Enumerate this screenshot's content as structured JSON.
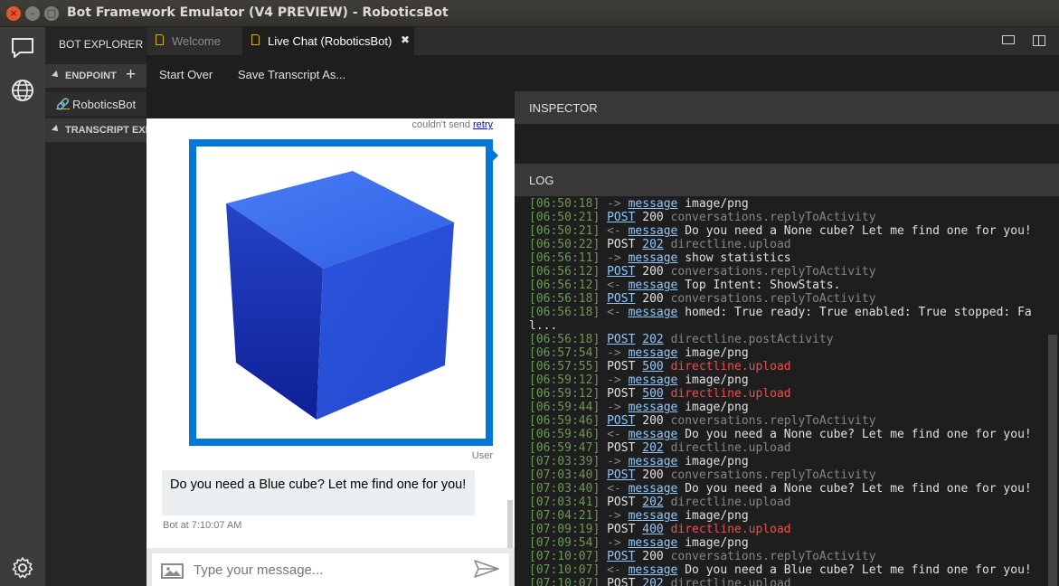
{
  "window": {
    "title": "Bot Framework Emulator (V4 PREVIEW) - RoboticsBot",
    "close_glyph": "×",
    "minimize_glyph": "–",
    "maximize_glyph": "□"
  },
  "activity_bar": {
    "icons": [
      "chat-icon",
      "globe-icon",
      "settings-gear-icon"
    ]
  },
  "explorer": {
    "title": "BOT EXPLORER",
    "endpoint_section": "ENDPOINT",
    "add_glyph": "+",
    "endpoint_item": "RoboticsBot",
    "transcript_section": "TRANSCRIPT EXPLORER"
  },
  "tabs": [
    {
      "label": "Welcome",
      "active": false
    },
    {
      "label": "Live Chat (RoboticsBot)",
      "active": true,
      "close_glyph": "✖"
    }
  ],
  "toolbar": {
    "start_over": "Start Over",
    "save_transcript": "Save Transcript As..."
  },
  "chat": {
    "status_text": "couldn't send",
    "retry_label": "retry",
    "user_label": "User",
    "bot_message": "Do you need a Blue cube? Let me find one for you!",
    "bot_time": "Bot at 7:10:07 AM",
    "input_placeholder": "Type your message...",
    "image_subject": "blue cube"
  },
  "inspector": {
    "title": "INSPECTOR"
  },
  "log": {
    "title": "LOG",
    "colors": {
      "timestamp": "#6a9955",
      "link": "#8ec8ff",
      "dim": "#858585",
      "error": "#f14c4c"
    },
    "entries": [
      {
        "time": "[06:50:18]",
        "dir": "->",
        "kind": "link",
        "method": "message",
        "detail": "image/png",
        "detail_style": "text"
      },
      {
        "time": "[06:50:21]",
        "dir": "",
        "kind": "link",
        "method": "POST",
        "status": "200",
        "status_style": "text",
        "detail": "conversations.replyToActivity",
        "detail_style": "dim"
      },
      {
        "time": "[06:50:21]",
        "dir": "<-",
        "kind": "link",
        "method": "message",
        "detail": "Do you need a None cube? Let me find one for you!",
        "detail_style": "text"
      },
      {
        "time": "[06:50:22]",
        "dir": "",
        "kind": "text",
        "method": "POST",
        "status": "202",
        "status_style": "link",
        "detail": "directline.upload",
        "detail_style": "dim"
      },
      {
        "time": "[06:56:11]",
        "dir": "->",
        "kind": "link",
        "method": "message",
        "detail": "show statistics",
        "detail_style": "text"
      },
      {
        "time": "[06:56:12]",
        "dir": "",
        "kind": "link",
        "method": "POST",
        "status": "200",
        "status_style": "text",
        "detail": "conversations.replyToActivity",
        "detail_style": "dim"
      },
      {
        "time": "[06:56:12]",
        "dir": "<-",
        "kind": "link",
        "method": "message",
        "detail": "Top Intent: ShowStats.",
        "detail_style": "text"
      },
      {
        "time": "[06:56:18]",
        "dir": "",
        "kind": "link",
        "method": "POST",
        "status": "200",
        "status_style": "text",
        "detail": "conversations.replyToActivity",
        "detail_style": "dim"
      },
      {
        "time": "[06:56:18]",
        "dir": "<-",
        "kind": "link",
        "method": "message",
        "detail": "homed: True ready: True enabled: True stopped: Fal...",
        "detail_style": "text"
      },
      {
        "time": "[06:56:18]",
        "dir": "",
        "kind": "link",
        "method": "POST",
        "status": "202",
        "status_style": "link",
        "detail": "directline.postActivity",
        "detail_style": "dim"
      },
      {
        "time": "[06:57:54]",
        "dir": "->",
        "kind": "link",
        "method": "message",
        "detail": "image/png",
        "detail_style": "text"
      },
      {
        "time": "[06:57:55]",
        "dir": "",
        "kind": "text",
        "method": "POST",
        "status": "500",
        "status_style": "link",
        "detail": "directline.upload",
        "detail_style": "err"
      },
      {
        "time": "[06:59:12]",
        "dir": "->",
        "kind": "link",
        "method": "message",
        "detail": "image/png",
        "detail_style": "text"
      },
      {
        "time": "[06:59:12]",
        "dir": "",
        "kind": "text",
        "method": "POST",
        "status": "500",
        "status_style": "link",
        "detail": "directline.upload",
        "detail_style": "err"
      },
      {
        "time": "[06:59:44]",
        "dir": "->",
        "kind": "link",
        "method": "message",
        "detail": "image/png",
        "detail_style": "text"
      },
      {
        "time": "[06:59:46]",
        "dir": "",
        "kind": "link",
        "method": "POST",
        "status": "200",
        "status_style": "text",
        "detail": "conversations.replyToActivity",
        "detail_style": "dim"
      },
      {
        "time": "[06:59:46]",
        "dir": "<-",
        "kind": "link",
        "method": "message",
        "detail": "Do you need a None cube? Let me find one for you!",
        "detail_style": "text"
      },
      {
        "time": "[06:59:47]",
        "dir": "",
        "kind": "text",
        "method": "POST",
        "status": "202",
        "status_style": "link",
        "detail": "directline.upload",
        "detail_style": "dim"
      },
      {
        "time": "[07:03:39]",
        "dir": "->",
        "kind": "link",
        "method": "message",
        "detail": "image/png",
        "detail_style": "text"
      },
      {
        "time": "[07:03:40]",
        "dir": "",
        "kind": "link",
        "method": "POST",
        "status": "200",
        "status_style": "text",
        "detail": "conversations.replyToActivity",
        "detail_style": "dim"
      },
      {
        "time": "[07:03:40]",
        "dir": "<-",
        "kind": "link",
        "method": "message",
        "detail": "Do you need a None cube? Let me find one for you!",
        "detail_style": "text"
      },
      {
        "time": "[07:03:41]",
        "dir": "",
        "kind": "text",
        "method": "POST",
        "status": "202",
        "status_style": "link",
        "detail": "directline.upload",
        "detail_style": "dim"
      },
      {
        "time": "[07:04:21]",
        "dir": "->",
        "kind": "link",
        "method": "message",
        "detail": "image/png",
        "detail_style": "text"
      },
      {
        "time": "[07:09:19]",
        "dir": "",
        "kind": "text",
        "method": "POST",
        "status": "400",
        "status_style": "link",
        "detail": "directline.upload",
        "detail_style": "err"
      },
      {
        "time": "[07:09:54]",
        "dir": "->",
        "kind": "link",
        "method": "message",
        "detail": "image/png",
        "detail_style": "text"
      },
      {
        "time": "[07:10:07]",
        "dir": "",
        "kind": "link",
        "method": "POST",
        "status": "200",
        "status_style": "text",
        "detail": "conversations.replyToActivity",
        "detail_style": "dim"
      },
      {
        "time": "[07:10:07]",
        "dir": "<-",
        "kind": "link",
        "method": "message",
        "detail": "Do you need a Blue cube? Let me find one for you!",
        "detail_style": "text"
      },
      {
        "time": "[07:10:07]",
        "dir": "",
        "kind": "text",
        "method": "POST",
        "status": "202",
        "status_style": "link",
        "detail": "directline.upload",
        "detail_style": "dim"
      }
    ]
  }
}
